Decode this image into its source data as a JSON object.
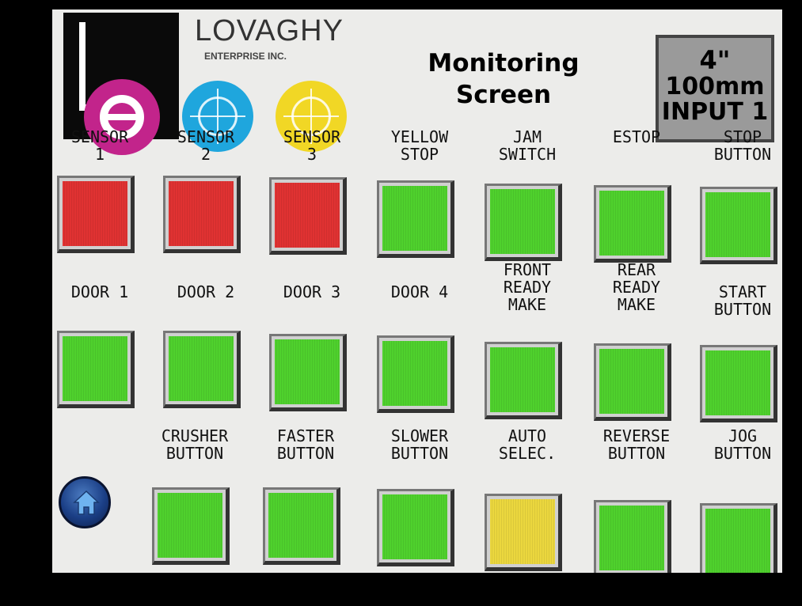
{
  "brand": {
    "name": "LOVAGHY",
    "subtitle": "ENTERPRISE INC."
  },
  "screen_title": "Monitoring\nScreen",
  "size_box": {
    "line1": "4\"",
    "line2": "100mm",
    "line3": "INPUT 1"
  },
  "colors": {
    "red": "#e03232",
    "green": "#4fd12d",
    "yellow": "#ebd73e",
    "background": "#ececea"
  },
  "home_icon": "home-icon",
  "rows": [
    {
      "indicators": [
        {
          "label": "SENSOR\n1",
          "state": "red"
        },
        {
          "label": "SENSOR\n2",
          "state": "red"
        },
        {
          "label": "SENSOR\n3",
          "state": "red"
        },
        {
          "label": "YELLOW\nSTOP",
          "state": "green"
        },
        {
          "label": "JAM\nSWITCH",
          "state": "green"
        },
        {
          "label": "ESTOP",
          "state": "green"
        },
        {
          "label": "STOP\nBUTTON",
          "state": "green"
        }
      ]
    },
    {
      "indicators": [
        {
          "label": "DOOR 1",
          "state": "green"
        },
        {
          "label": "DOOR 2",
          "state": "green"
        },
        {
          "label": "DOOR 3",
          "state": "green"
        },
        {
          "label": "DOOR 4",
          "state": "green"
        },
        {
          "label": "FRONT\nREADY\nMAKE",
          "state": "green"
        },
        {
          "label": "REAR\nREADY\nMAKE",
          "state": "green"
        },
        {
          "label": "START\nBUTTON",
          "state": "green"
        }
      ]
    },
    {
      "indicators": [
        {
          "label": "CRUSHER\nBUTTON",
          "state": "green"
        },
        {
          "label": "FASTER\nBUTTON",
          "state": "green"
        },
        {
          "label": "SLOWER\nBUTTON",
          "state": "green"
        },
        {
          "label": "AUTO\nSELEC.",
          "state": "yellow"
        },
        {
          "label": "REVERSE\nBUTTON",
          "state": "green"
        },
        {
          "label": "JOG\nBUTTON",
          "state": "green"
        }
      ]
    }
  ]
}
